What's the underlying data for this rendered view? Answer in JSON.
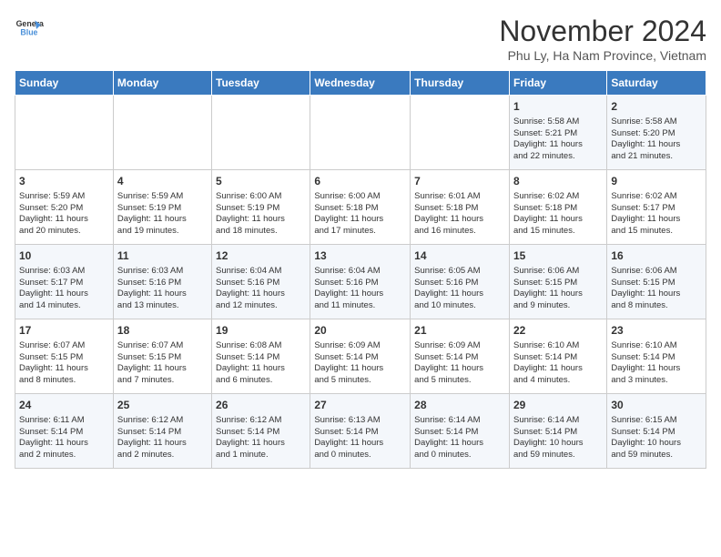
{
  "header": {
    "logo_line1": "General",
    "logo_line2": "Blue",
    "month_title": "November 2024",
    "location": "Phu Ly, Ha Nam Province, Vietnam"
  },
  "weekdays": [
    "Sunday",
    "Monday",
    "Tuesday",
    "Wednesday",
    "Thursday",
    "Friday",
    "Saturday"
  ],
  "weeks": [
    [
      {
        "day": "",
        "info": ""
      },
      {
        "day": "",
        "info": ""
      },
      {
        "day": "",
        "info": ""
      },
      {
        "day": "",
        "info": ""
      },
      {
        "day": "",
        "info": ""
      },
      {
        "day": "1",
        "info": "Sunrise: 5:58 AM\nSunset: 5:21 PM\nDaylight: 11 hours\nand 22 minutes."
      },
      {
        "day": "2",
        "info": "Sunrise: 5:58 AM\nSunset: 5:20 PM\nDaylight: 11 hours\nand 21 minutes."
      }
    ],
    [
      {
        "day": "3",
        "info": "Sunrise: 5:59 AM\nSunset: 5:20 PM\nDaylight: 11 hours\nand 20 minutes."
      },
      {
        "day": "4",
        "info": "Sunrise: 5:59 AM\nSunset: 5:19 PM\nDaylight: 11 hours\nand 19 minutes."
      },
      {
        "day": "5",
        "info": "Sunrise: 6:00 AM\nSunset: 5:19 PM\nDaylight: 11 hours\nand 18 minutes."
      },
      {
        "day": "6",
        "info": "Sunrise: 6:00 AM\nSunset: 5:18 PM\nDaylight: 11 hours\nand 17 minutes."
      },
      {
        "day": "7",
        "info": "Sunrise: 6:01 AM\nSunset: 5:18 PM\nDaylight: 11 hours\nand 16 minutes."
      },
      {
        "day": "8",
        "info": "Sunrise: 6:02 AM\nSunset: 5:18 PM\nDaylight: 11 hours\nand 15 minutes."
      },
      {
        "day": "9",
        "info": "Sunrise: 6:02 AM\nSunset: 5:17 PM\nDaylight: 11 hours\nand 15 minutes."
      }
    ],
    [
      {
        "day": "10",
        "info": "Sunrise: 6:03 AM\nSunset: 5:17 PM\nDaylight: 11 hours\nand 14 minutes."
      },
      {
        "day": "11",
        "info": "Sunrise: 6:03 AM\nSunset: 5:16 PM\nDaylight: 11 hours\nand 13 minutes."
      },
      {
        "day": "12",
        "info": "Sunrise: 6:04 AM\nSunset: 5:16 PM\nDaylight: 11 hours\nand 12 minutes."
      },
      {
        "day": "13",
        "info": "Sunrise: 6:04 AM\nSunset: 5:16 PM\nDaylight: 11 hours\nand 11 minutes."
      },
      {
        "day": "14",
        "info": "Sunrise: 6:05 AM\nSunset: 5:16 PM\nDaylight: 11 hours\nand 10 minutes."
      },
      {
        "day": "15",
        "info": "Sunrise: 6:06 AM\nSunset: 5:15 PM\nDaylight: 11 hours\nand 9 minutes."
      },
      {
        "day": "16",
        "info": "Sunrise: 6:06 AM\nSunset: 5:15 PM\nDaylight: 11 hours\nand 8 minutes."
      }
    ],
    [
      {
        "day": "17",
        "info": "Sunrise: 6:07 AM\nSunset: 5:15 PM\nDaylight: 11 hours\nand 8 minutes."
      },
      {
        "day": "18",
        "info": "Sunrise: 6:07 AM\nSunset: 5:15 PM\nDaylight: 11 hours\nand 7 minutes."
      },
      {
        "day": "19",
        "info": "Sunrise: 6:08 AM\nSunset: 5:14 PM\nDaylight: 11 hours\nand 6 minutes."
      },
      {
        "day": "20",
        "info": "Sunrise: 6:09 AM\nSunset: 5:14 PM\nDaylight: 11 hours\nand 5 minutes."
      },
      {
        "day": "21",
        "info": "Sunrise: 6:09 AM\nSunset: 5:14 PM\nDaylight: 11 hours\nand 5 minutes."
      },
      {
        "day": "22",
        "info": "Sunrise: 6:10 AM\nSunset: 5:14 PM\nDaylight: 11 hours\nand 4 minutes."
      },
      {
        "day": "23",
        "info": "Sunrise: 6:10 AM\nSunset: 5:14 PM\nDaylight: 11 hours\nand 3 minutes."
      }
    ],
    [
      {
        "day": "24",
        "info": "Sunrise: 6:11 AM\nSunset: 5:14 PM\nDaylight: 11 hours\nand 2 minutes."
      },
      {
        "day": "25",
        "info": "Sunrise: 6:12 AM\nSunset: 5:14 PM\nDaylight: 11 hours\nand 2 minutes."
      },
      {
        "day": "26",
        "info": "Sunrise: 6:12 AM\nSunset: 5:14 PM\nDaylight: 11 hours\nand 1 minute."
      },
      {
        "day": "27",
        "info": "Sunrise: 6:13 AM\nSunset: 5:14 PM\nDaylight: 11 hours\nand 0 minutes."
      },
      {
        "day": "28",
        "info": "Sunrise: 6:14 AM\nSunset: 5:14 PM\nDaylight: 11 hours\nand 0 minutes."
      },
      {
        "day": "29",
        "info": "Sunrise: 6:14 AM\nSunset: 5:14 PM\nDaylight: 10 hours\nand 59 minutes."
      },
      {
        "day": "30",
        "info": "Sunrise: 6:15 AM\nSunset: 5:14 PM\nDaylight: 10 hours\nand 59 minutes."
      }
    ]
  ]
}
